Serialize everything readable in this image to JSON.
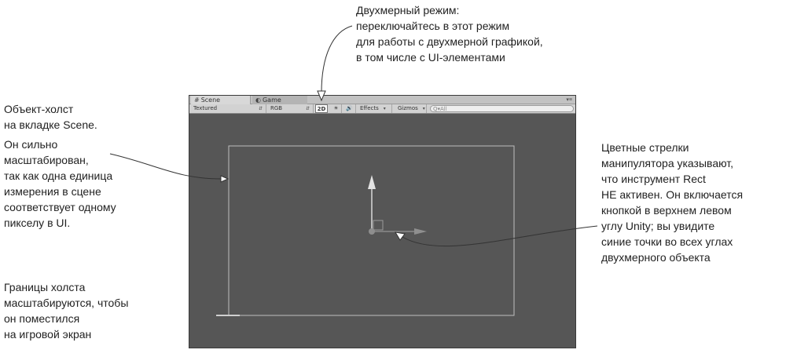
{
  "callouts": {
    "mode_2d": {
      "lines": [
        "Двухмерный режим:",
        "переключайтесь в этот режим",
        "для работы с двухмерной графикой,",
        "в том числе с UI-элементами"
      ]
    },
    "canvas_object": {
      "lines": [
        "Объект-холст",
        "на вкладке Scene."
      ]
    },
    "scaled": {
      "lines": [
        "Он сильно",
        "масштабирован,",
        "так как одна единица",
        "измерения в сцене",
        "соответствует одному",
        "пикселу в UI."
      ]
    },
    "bounds": {
      "lines": [
        "Границы холста",
        "масштабируются, чтобы",
        "он поместился",
        "на игровой экран"
      ]
    },
    "arrows": {
      "lines": [
        "Цветные стрелки",
        "манипулятора указывают,",
        "что инструмент Rect",
        "НЕ активен. Он включается",
        "кнопкой в верхнем левом",
        "углу Unity; вы увидите",
        "синие точки во всех углах",
        "двухмерного объекта"
      ]
    }
  },
  "unity": {
    "tabs": [
      {
        "label": "Scene",
        "icon": "grid-icon"
      },
      {
        "label": "Game",
        "icon": "pacman-icon"
      }
    ],
    "window_menu": "▾≡",
    "toolbar": {
      "shading_mode": "Textured",
      "render_mode": "RGB",
      "mode_2d": "2D",
      "lighting_icon": "☀",
      "audio_icon": "🔊",
      "effects": "Effects",
      "gizmos": "Gizmos",
      "search_placeholder": "Q▾All"
    },
    "colors": {
      "viewport": "#565656",
      "canvas_border": "#bdbdbd",
      "gizmo": "#d9d9d9"
    }
  }
}
